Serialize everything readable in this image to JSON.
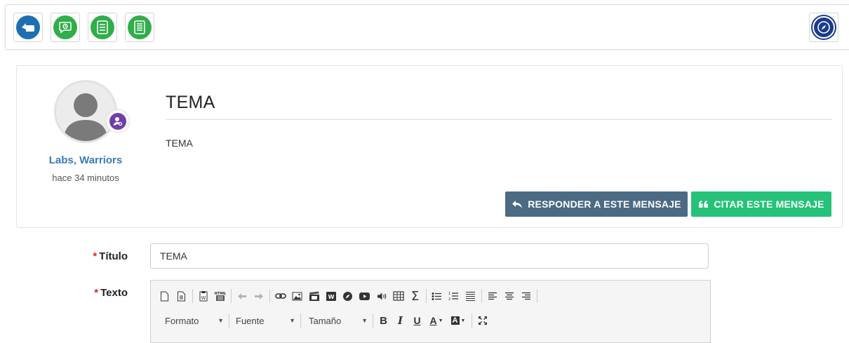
{
  "toolbar": {
    "buttons": [
      {
        "icon": "back-hand-icon",
        "color": "#1e6fb2"
      },
      {
        "icon": "history-chat-icon",
        "color": "#2fae4a"
      },
      {
        "icon": "list-icon",
        "color": "#2fae4a"
      },
      {
        "icon": "grid-list-icon",
        "color": "#2fae4a"
      }
    ],
    "right_icon": "compass-icon"
  },
  "post": {
    "author": "Labs, Warriors",
    "time": "hace 34 minutos",
    "title": "TEMA",
    "body": "TEMA",
    "reply_label": "RESPONDER A ESTE MENSAJE",
    "quote_label": "CITAR ESTE MENSAJE",
    "reply_color": "#4a6b83",
    "quote_color": "#26c27a"
  },
  "form": {
    "title_label": "Título",
    "title_value": "TEMA",
    "text_label": "Texto",
    "required_mark": "*",
    "editor": {
      "format_label": "Formato",
      "font_label": "Fuente",
      "size_label": "Tamaño",
      "bold": "B",
      "italic": "I",
      "underline": "U",
      "text_color": "A",
      "bg_color": "A"
    }
  }
}
